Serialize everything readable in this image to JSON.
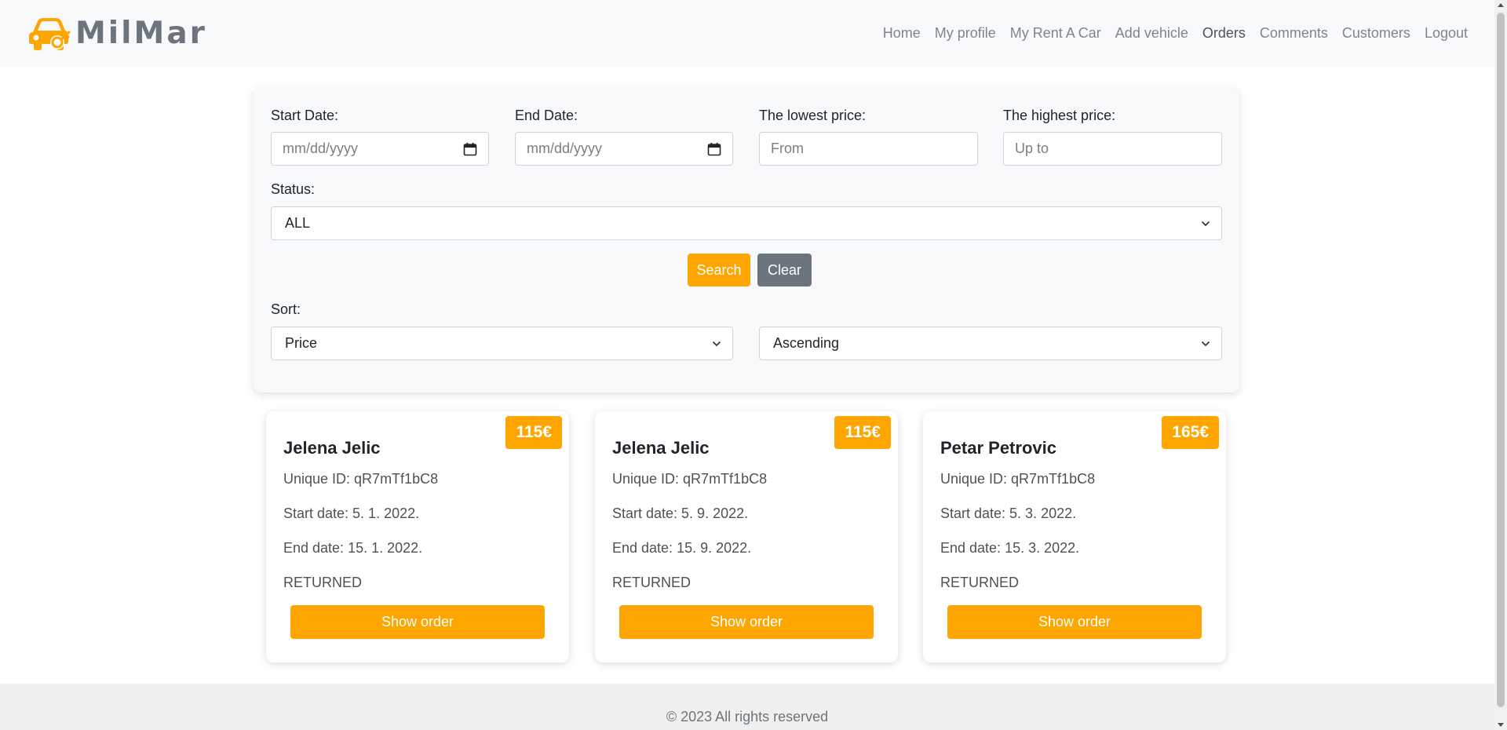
{
  "brand": {
    "name": "MilMar",
    "logo_icon": "car-key-icon",
    "accent": "#ffa500"
  },
  "nav": {
    "items": [
      {
        "label": "Home"
      },
      {
        "label": "My profile"
      },
      {
        "label": "My Rent A Car"
      },
      {
        "label": "Add vehicle"
      },
      {
        "label": "Orders",
        "active": true
      },
      {
        "label": "Comments"
      },
      {
        "label": "Customers"
      },
      {
        "label": "Logout"
      }
    ]
  },
  "filters": {
    "start_date": {
      "label": "Start Date:",
      "placeholder": "mm/dd/yyyy"
    },
    "end_date": {
      "label": "End Date:",
      "placeholder": "mm/dd/yyyy"
    },
    "lowest_price": {
      "label": "The lowest price:",
      "placeholder": "From"
    },
    "highest_price": {
      "label": "The highest price:",
      "placeholder": "Up to"
    },
    "status": {
      "label": "Status:",
      "value": "ALL"
    },
    "search_label": "Search",
    "clear_label": "Clear",
    "sort": {
      "label": "Sort:",
      "field": "Price",
      "direction": "Ascending"
    }
  },
  "orders": [
    {
      "price": "115€",
      "name": "Jelena Jelic",
      "unique_id": "Unique ID: qR7mTf1bC8",
      "start": "Start date: 5. 1. 2022.",
      "end": "End date: 15. 1. 2022.",
      "status": "RETURNED",
      "button": "Show order"
    },
    {
      "price": "115€",
      "name": "Jelena Jelic",
      "unique_id": "Unique ID: qR7mTf1bC8",
      "start": "Start date: 5. 9. 2022.",
      "end": "End date: 15. 9. 2022.",
      "status": "RETURNED",
      "button": "Show order"
    },
    {
      "price": "165€",
      "name": "Petar Petrovic",
      "unique_id": "Unique ID: qR7mTf1bC8",
      "start": "Start date: 5. 3. 2022.",
      "end": "End date: 15. 3. 2022.",
      "status": "RETURNED",
      "button": "Show order"
    }
  ],
  "footer": {
    "text": "© 2023 All rights reserved"
  }
}
